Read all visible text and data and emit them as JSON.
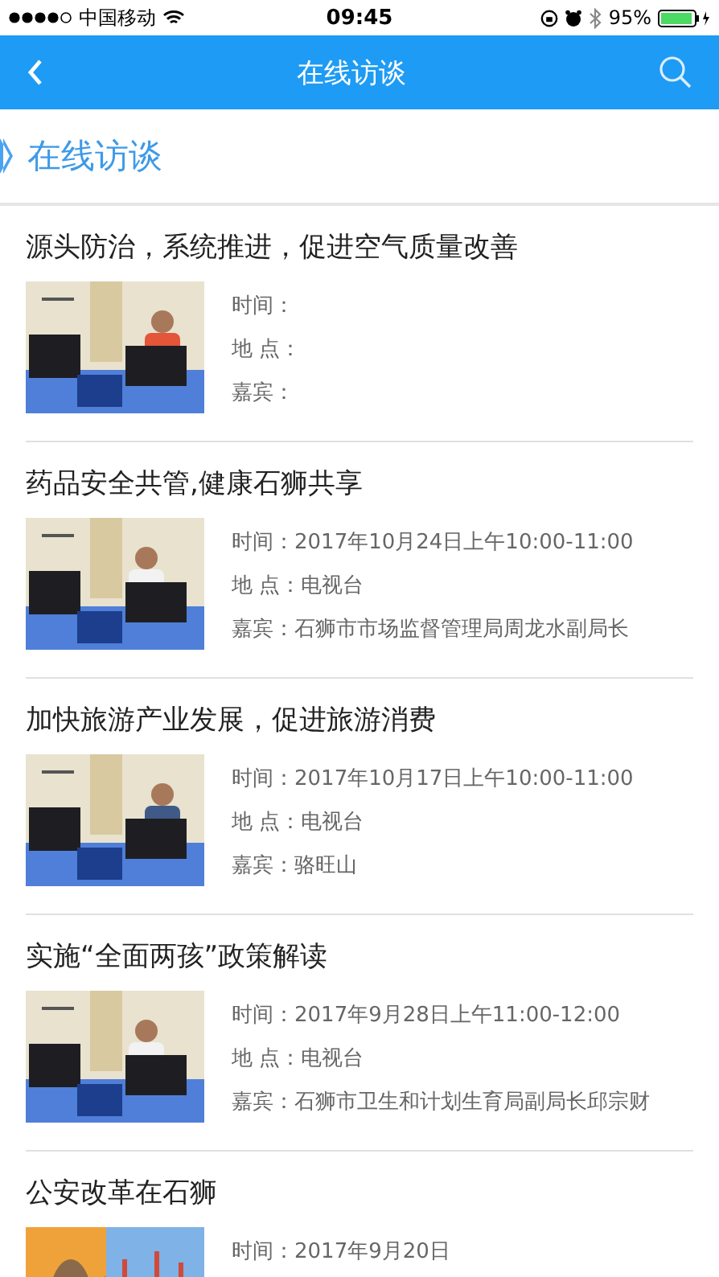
{
  "status_bar": {
    "carrier": "中国移动",
    "time": "09:45",
    "battery_text": "95%"
  },
  "nav_bar": {
    "title": "在线访谈"
  },
  "section": {
    "title": "在线访谈"
  },
  "interviews": [
    {
      "title": "源头防治，系统推进，促进空气质量改善",
      "fields": [
        {
          "label": "时间："
        },
        {
          "label": "地 点："
        },
        {
          "label": "嘉宾："
        }
      ]
    },
    {
      "title": "药品安全共管,健康石狮共享",
      "fields": [
        {
          "label": "时间：",
          "value": "2017年10月24日上午10:00-11:00"
        },
        {
          "label": "地 点：",
          "value": "电视台"
        },
        {
          "label": "嘉宾：",
          "value": "石狮市市场监督管理局周龙水副局长"
        }
      ]
    },
    {
      "title": "加快旅游产业发展，促进旅游消费",
      "fields": [
        {
          "label": "时间：",
          "value": "2017年10月17日上午10:00-11:00"
        },
        {
          "label": "地 点：",
          "value": "电视台"
        },
        {
          "label": "嘉宾：",
          "value": "骆旺山"
        }
      ]
    },
    {
      "title": "实施“全面两孩”政策解读",
      "fields": [
        {
          "label": "时间：",
          "value": "2017年9月28日上午11:00-12:00"
        },
        {
          "label": "地 点：",
          "value": "电视台"
        },
        {
          "label": "嘉宾：",
          "value": "石狮市卫生和计划生育局副局长邱宗财"
        }
      ]
    },
    {
      "title": "公安改革在石狮",
      "fields": [
        {
          "label": "时间：",
          "value": "2017年9月20日"
        }
      ]
    }
  ]
}
